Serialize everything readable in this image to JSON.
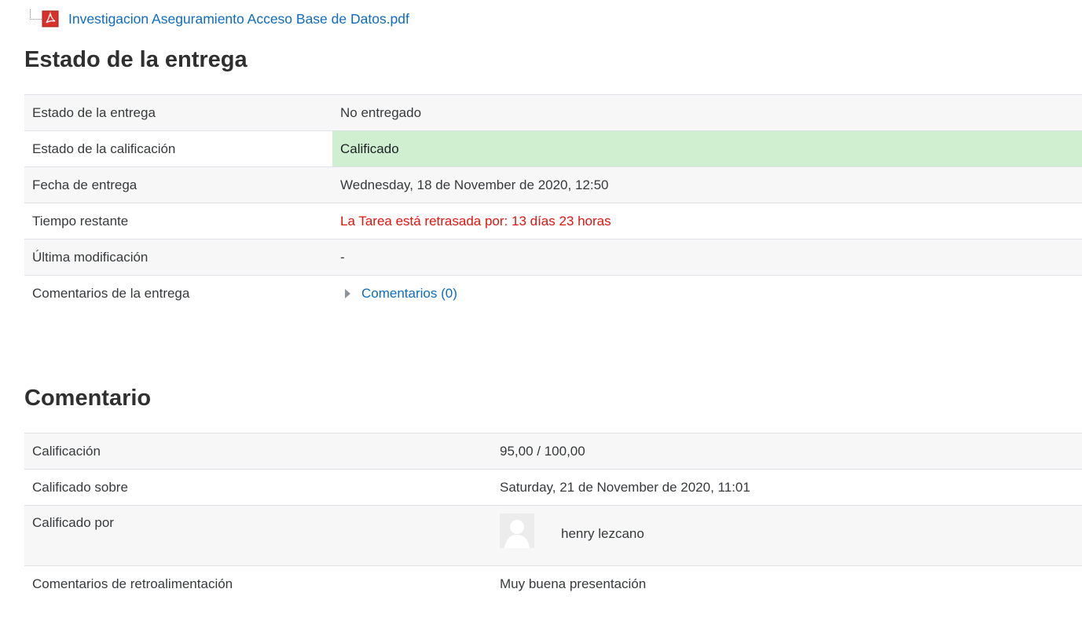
{
  "attachment": {
    "filename": "Investigacion Aseguramiento Acceso Base de Datos.pdf",
    "icon": "pdf-file-icon"
  },
  "submission_status": {
    "heading": "Estado de la entrega",
    "rows": [
      {
        "label": "Estado de la entrega",
        "value": "No entregado"
      },
      {
        "label": "Estado de la calificación",
        "value": "Calificado"
      },
      {
        "label": "Fecha de entrega",
        "value": "Wednesday, 18 de November de 2020, 12:50"
      },
      {
        "label": "Tiempo restante",
        "value": "La Tarea está retrasada por: 13 días 23 horas"
      },
      {
        "label": "Última modificación",
        "value": "-"
      },
      {
        "label": "Comentarios de la entrega",
        "value": "Comentarios (0)"
      }
    ]
  },
  "feedback": {
    "heading": "Comentario",
    "rows": [
      {
        "label": "Calificación",
        "value": "95,00 / 100,00"
      },
      {
        "label": "Calificado sobre",
        "value": "Saturday, 21 de November de 2020, 11:01"
      },
      {
        "label": "Calificado por",
        "value": "henry lezcano"
      },
      {
        "label": "Comentarios de retroalimentación",
        "value": "Muy buena presentación"
      }
    ]
  },
  "colors": {
    "link": "#0f6cbf",
    "graded_bg": "#cfefd0",
    "overdue_text": "#e3140f"
  }
}
